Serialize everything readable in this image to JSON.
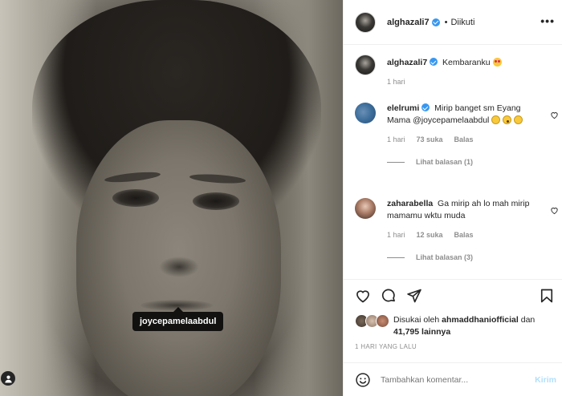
{
  "post": {
    "author": "alghazali7",
    "follow_status": "Diikuti",
    "dot": "•",
    "more": "•••",
    "photo_tag": "joycepamelaabdul"
  },
  "caption": {
    "user": "alghazali7",
    "text": "Kembaranku",
    "time": "1 hari"
  },
  "comments": [
    {
      "user": "elelrumi",
      "text": "Mirip banget sm Eyang Mama @joycepamelaabdul",
      "time": "1 hari",
      "likes": "73 suka",
      "reply": "Balas",
      "view_replies": "Lihat balasan (1)"
    },
    {
      "user": "zaharabella",
      "text": "Ga mirip ah lo mah mirip mamamu wktu muda",
      "time": "1 hari",
      "likes": "12 suka",
      "reply": "Balas",
      "view_replies": "Lihat balasan (3)"
    }
  ],
  "likes": {
    "prefix": "Disukai oleh",
    "user": "ahmaddhaniofficial",
    "conj": "dan",
    "count": "41,795 lainnya"
  },
  "date": "1 HARI YANG LALU",
  "add_comment": {
    "placeholder": "Tambahkan komentar...",
    "post": "Kirim"
  },
  "colors": {
    "verified": "#3897f0",
    "post_disabled": "#b2dffc",
    "muted": "#8e8e8e"
  }
}
